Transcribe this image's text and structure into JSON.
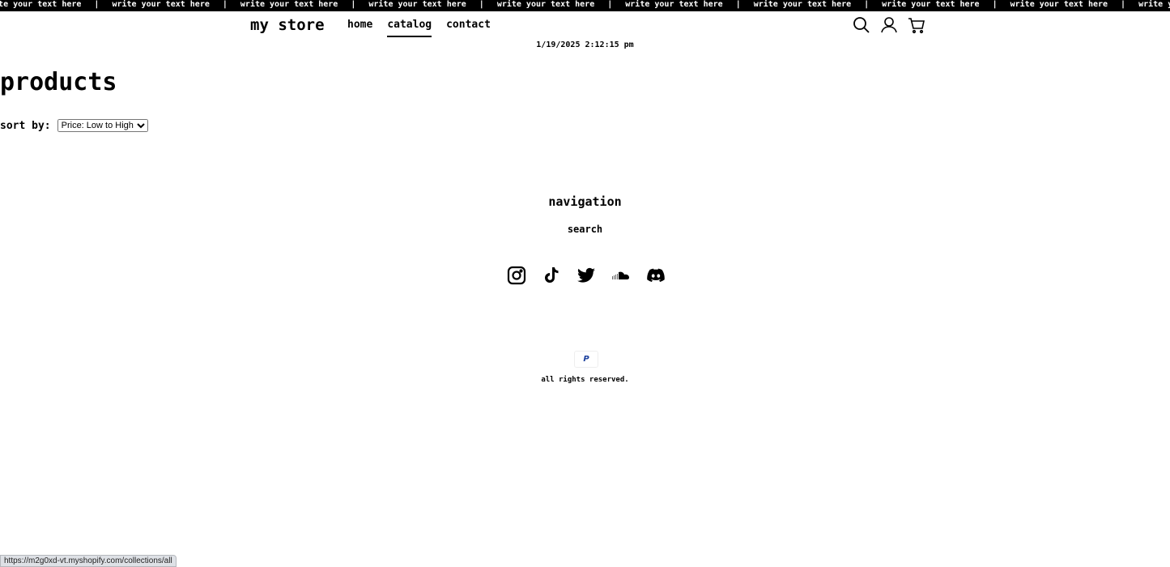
{
  "announcement": {
    "text": "write your text here",
    "separator": "|"
  },
  "header": {
    "logo": "my store",
    "nav": [
      {
        "label": "home"
      },
      {
        "label": "catalog",
        "active": true
      },
      {
        "label": "contact"
      }
    ],
    "icons": [
      "search-icon",
      "account-icon",
      "cart-icon"
    ]
  },
  "datetime": "1/19/2025 2:12:15 pm",
  "main": {
    "title": "products",
    "sort_label": "sort by:",
    "sort_value": "Price: Low to High"
  },
  "footer": {
    "nav_title": "navigation",
    "links": [
      {
        "label": "search"
      }
    ],
    "social": [
      "instagram-icon",
      "tiktok-icon",
      "twitter-icon",
      "soundcloud-icon",
      "discord-icon"
    ],
    "payment": "P",
    "rights": "all rights reserved."
  },
  "status_url": "https://m2g0xd-vt.myshopify.com/collections/all"
}
